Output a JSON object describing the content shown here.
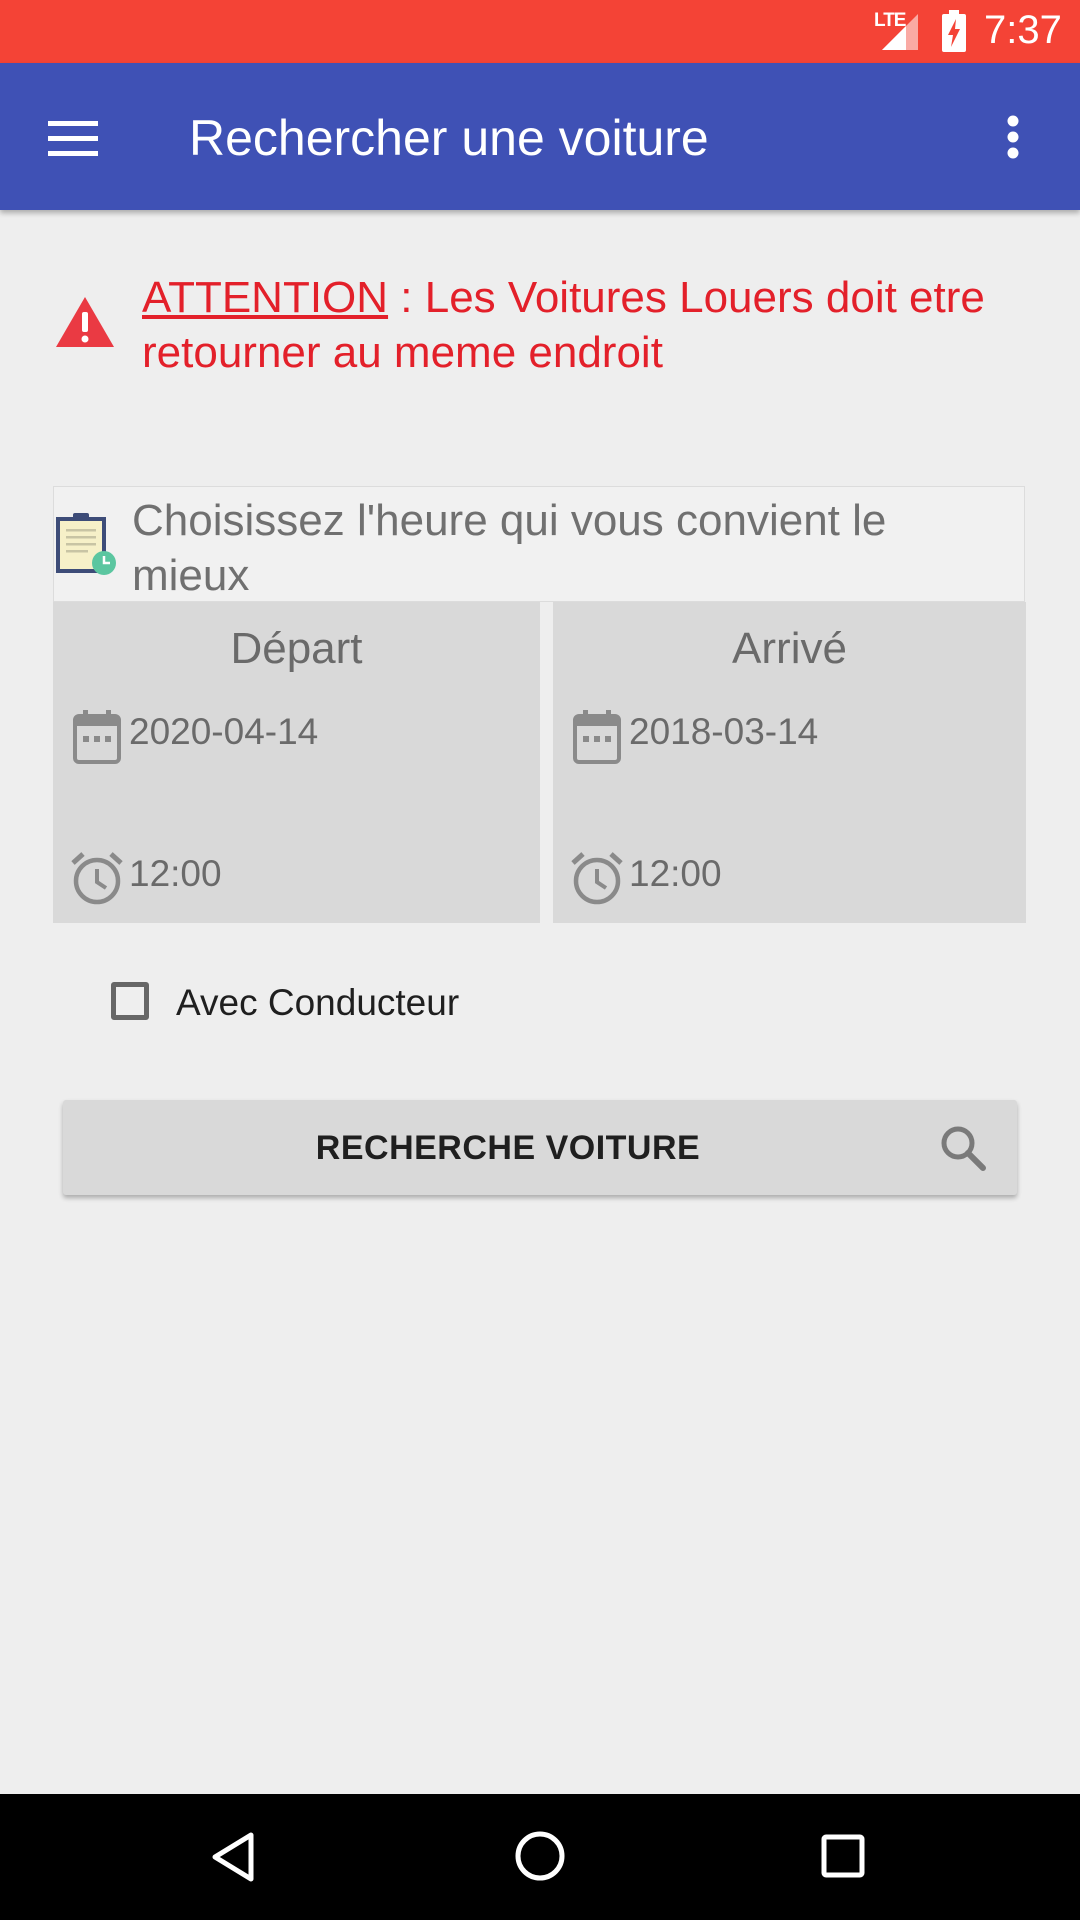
{
  "status_bar": {
    "network": "LTE",
    "time": "7:37",
    "color": "#f44336"
  },
  "app_bar": {
    "title": "Rechercher une voiture",
    "color": "#3f51b5",
    "menu_icon": "hamburger-menu-icon",
    "overflow_icon": "more-vert-icon"
  },
  "warning": {
    "icon": "warning-triangle-icon",
    "label": "ATTENTION",
    "message": " : Les Voitures Louers doit etre retourner au meme endroit",
    "color": "#e3202a"
  },
  "time_selection": {
    "header_icon": "clipboard-clock-icon",
    "header": "Choisissez l'heure qui vous convient le mieux",
    "departure": {
      "title": "Départ",
      "date": "2020-04-14",
      "time": "12:00"
    },
    "arrival": {
      "title": "Arrivé",
      "date": "2018-03-14",
      "time": "12:00"
    }
  },
  "driver_option": {
    "label": "Avec Conducteur",
    "checked": false
  },
  "search_button": {
    "label": "RECHERCHE VOITURE",
    "icon": "search-icon"
  },
  "nav_bar": {
    "back_icon": "back-icon",
    "home_icon": "home-icon",
    "recents_icon": "recents-icon"
  }
}
